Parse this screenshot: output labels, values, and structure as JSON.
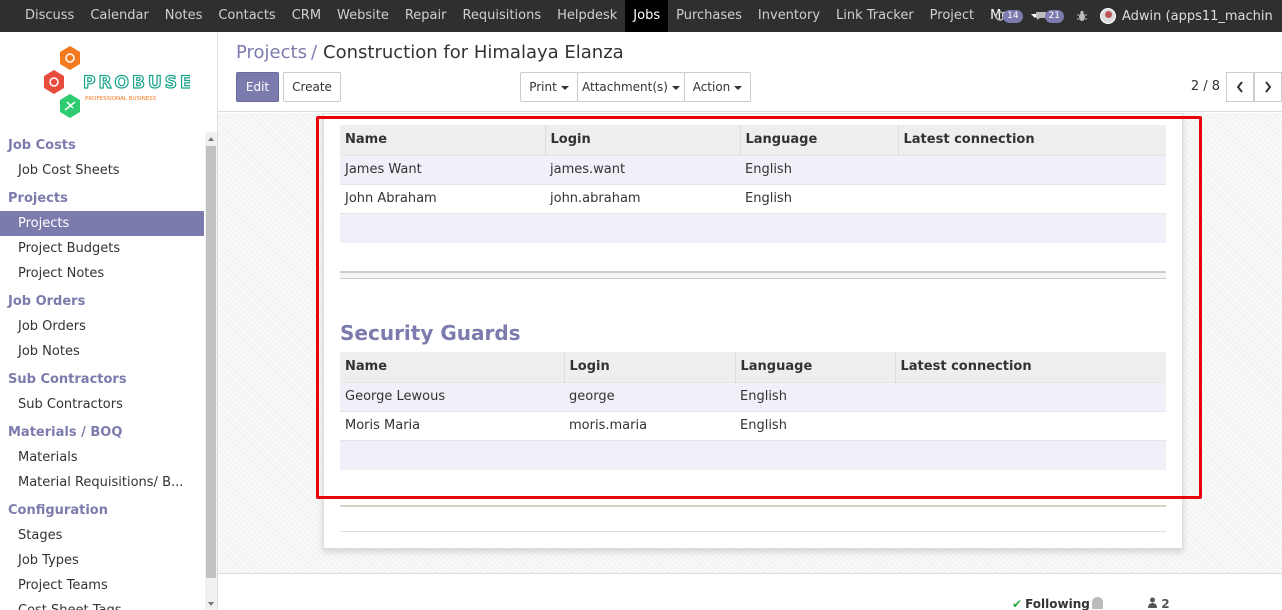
{
  "topnav": {
    "items": [
      "Discuss",
      "Calendar",
      "Notes",
      "Contacts",
      "CRM",
      "Website",
      "Repair",
      "Requisitions",
      "Helpdesk",
      "Jobs",
      "Purchases",
      "Inventory",
      "Link Tracker",
      "Project"
    ],
    "active": "Jobs",
    "more_label": "More",
    "activity_count": "14",
    "message_count": "21",
    "user_name": "Adwin (apps11_machin"
  },
  "logo": {
    "brand": "PROBUSE",
    "tagline": "PROFESSIONAL BUSINESS"
  },
  "sidebar": {
    "sections": [
      {
        "title": "Job Costs",
        "items": [
          "Job Cost Sheets"
        ]
      },
      {
        "title": "Projects",
        "items": [
          "Projects",
          "Project Budgets",
          "Project Notes"
        ]
      },
      {
        "title": "Job Orders",
        "items": [
          "Job Orders",
          "Job Notes"
        ]
      },
      {
        "title": "Sub Contractors",
        "items": [
          "Sub Contractors"
        ]
      },
      {
        "title": "Materials / BOQ",
        "items": [
          "Materials",
          "Material Requisitions/ B..."
        ]
      },
      {
        "title": "Configuration",
        "items": [
          "Stages",
          "Job Types",
          "Project Teams",
          "Cost Sheet Tags"
        ]
      }
    ],
    "active_item": "Projects"
  },
  "breadcrumb": {
    "parent": "Projects",
    "separator": "/",
    "current": "Construction for Himalaya Elanza"
  },
  "toolbar": {
    "edit_label": "Edit",
    "create_label": "Create",
    "print_label": "Print",
    "attachments_label": "Attachment(s)",
    "action_label": "Action"
  },
  "pager": {
    "value": "2 / 8"
  },
  "table1": {
    "columns": [
      "Name",
      "Login",
      "Language",
      "Latest connection"
    ],
    "rows": [
      [
        "James Want",
        "james.want",
        "English",
        ""
      ],
      [
        "John Abraham",
        "john.abraham",
        "English",
        ""
      ]
    ]
  },
  "security_guards": {
    "title": "Security Guards",
    "columns": [
      "Name",
      "Login",
      "Language",
      "Latest connection"
    ],
    "rows": [
      [
        "George Lewous",
        "george",
        "English",
        ""
      ],
      [
        "Moris Maria",
        "moris.maria",
        "English",
        ""
      ]
    ]
  },
  "chatter": {
    "following_label": "Following",
    "followers_count": "2"
  },
  "colors": {
    "brand": "#7c7bad",
    "highlight": "#e8000c",
    "topbar": "#2f2f2f"
  }
}
